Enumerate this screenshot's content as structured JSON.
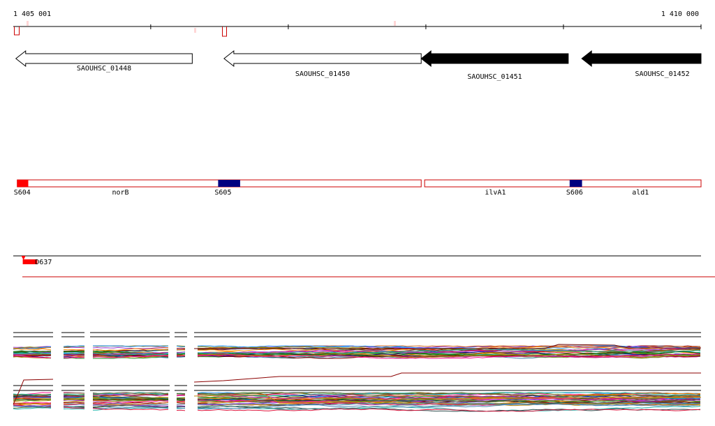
{
  "ruler": {
    "start_label": "1 405 001",
    "end_label": "1 410 000",
    "start": 1405001,
    "end": 1410000,
    "tick_step": 1000
  },
  "genes": [
    {
      "id": "SAOUHSC_01448",
      "label": "SAOUHSC_01448",
      "start": 1405020,
      "end": 1406302,
      "strand": "-",
      "fill": "#ffffff"
    },
    {
      "id": "SAOUHSC_01450",
      "label": "SAOUHSC_01450",
      "start": 1406533,
      "end": 1407966,
      "strand": "-",
      "fill": "#ffffff"
    },
    {
      "id": "SAOUHSC_01451",
      "label": "SAOUHSC_01451",
      "start": 1407966,
      "end": 1409035,
      "strand": "-",
      "fill": "#000000"
    },
    {
      "id": "SAOUHSC_01452",
      "label": "SAOUHSC_01452",
      "start": 1409133,
      "end": 1410000,
      "strand": "-",
      "fill": "#000000"
    }
  ],
  "operon_segments": [
    {
      "label": "norB",
      "start": 1405030,
      "end": 1407966
    },
    {
      "label": "ilvA1 ald1",
      "start": 1407991,
      "end": 1410000,
      "names": [
        "ilvA1",
        "ald1"
      ]
    }
  ],
  "transcript_sites": [
    {
      "label": "S604",
      "start": 1405030,
      "end": 1405110,
      "color": "#ff0000"
    },
    {
      "label": "S605",
      "start": 1406490,
      "end": 1406650,
      "color": "#000080"
    },
    {
      "label": "S606",
      "start": 1409045,
      "end": 1409135,
      "color": "#000080"
    }
  ],
  "segment_name_labels": [
    {
      "text": "norB",
      "pos": 1405780
    },
    {
      "text": "ilvA1",
      "pos": 1408505
    },
    {
      "text": "ald1",
      "pos": 1409560
    }
  ],
  "feature_track": {
    "label": "D637",
    "start": 1405070,
    "end": 1405175,
    "color": "#ff0000"
  },
  "colors": {
    "ruler_mark": "#cc0000",
    "operon_outline": "#cc0000",
    "reference_line": "#cc0000"
  }
}
